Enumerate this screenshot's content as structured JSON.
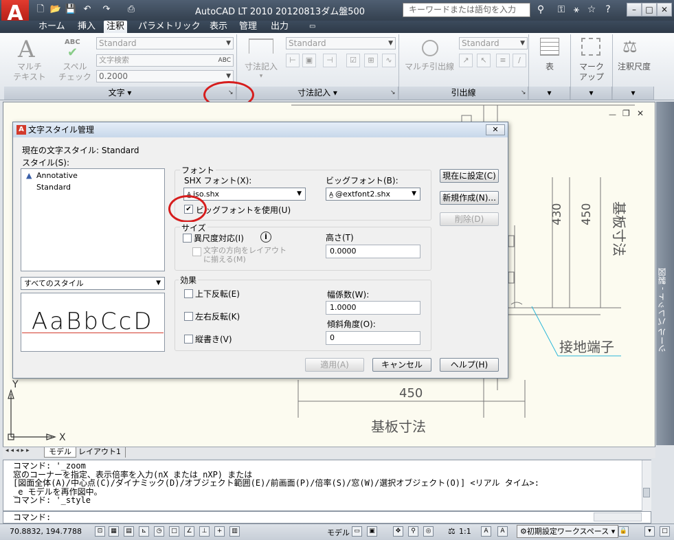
{
  "titlebar": {
    "app_logo": "A",
    "title": "AutoCAD LT 2010    20120813ダム盤500",
    "search_placeholder": "キーワードまたは語句を入力",
    "quick_access_icons": [
      "new-icon",
      "open-icon",
      "save-icon",
      "undo-icon",
      "redo-icon",
      "print-icon"
    ],
    "window_buttons": {
      "minimize": "–",
      "restore": "□",
      "close": "✕"
    }
  },
  "tabs": [
    "ホーム",
    "挿入",
    "注釈",
    "パラメトリック",
    "表示",
    "管理",
    "出力"
  ],
  "ribbon": {
    "text_panel": {
      "multi_text": "マルチ\nテキスト",
      "spell_check": "スペル\nチェック",
      "abc": "ABC",
      "style_combo": "Standard",
      "find_text": "文字検索",
      "height_combo": "0.2000",
      "footer": "文字 ▾"
    },
    "dim_panel": {
      "dim_button": "寸法記入",
      "style_combo": "Standard",
      "footer": "寸法記入 ▾"
    },
    "leader_panel": {
      "mleader_button": "マルチ引出線",
      "style_combo": "Standard",
      "footer": "引出線"
    },
    "table_button": "表",
    "markup_button": "マーク\nアップ",
    "anno_scale_button": "注釈尺度"
  },
  "dialog": {
    "title": "文字スタイル管理",
    "current_style_label": "現在の文字スタイル: Standard",
    "styles_label": "スタイル(S):",
    "styles": [
      "Annotative",
      "Standard"
    ],
    "filter_dropdown": "すべてのスタイル",
    "preview_text": "AaBbCcD",
    "font_group": "フォント",
    "shx_font_label": "SHX フォント(X):",
    "shx_font_value": "iso.shx",
    "big_font_label": "ビッグフォント(B):",
    "big_font_value": "@extfont2.shx",
    "use_big_font": "ビッグフォントを使用(U)",
    "size_group": "サイズ",
    "annotative": "異尺度対応(I)",
    "match_orientation": "文字の方向をレイアウト\nに揃える(M)",
    "height_label": "高さ(T)",
    "height_value": "0.0000",
    "effects_group": "効果",
    "upside_down": "上下反転(E)",
    "backwards": "左右反転(K)",
    "vertical": "縦書き(V)",
    "width_label": "幅係数(W):",
    "width_value": "1.0000",
    "oblique_label": "傾斜角度(O):",
    "oblique_value": "0",
    "set_current": "現在に設定(C)",
    "new": "新規作成(N)...",
    "delete": "削除(D)",
    "apply": "適用(A)",
    "cancel": "キャンセル",
    "help": "ヘルプ(H)"
  },
  "drawing": {
    "dim_450_bottom": "450",
    "board_dim": "基板寸法",
    "ground_terminal": "接地端子",
    "dim_430": "430",
    "dim_450": "450",
    "board_dim_vertical": "基板寸法",
    "axis_y": "Y",
    "axis_x": "X"
  },
  "palette_label": "ツール パレット - 製図",
  "layout_tabs": [
    "モデル",
    "レイアウト1"
  ],
  "command_lines": [
    "コマンド: '_zoom",
    "窓のコーナーを指定、表示倍率を入力(nX または nXP) または",
    "[図面全体(A)/中心点(C)/ダイナミック(D)/オブジェクト範囲(E)/前画面(P)/倍率(S)/窓(W)/選択オブジェクト(O)] <リアル タイム>:",
    "_e モデルを再作図中。",
    "コマンド: '_style"
  ],
  "command_prompt": "コマンド:",
  "status": {
    "coords": "70.8832, 194.7788",
    "model": "モデル",
    "scale": "1:1",
    "workspace": "初期設定ワークスペース"
  }
}
